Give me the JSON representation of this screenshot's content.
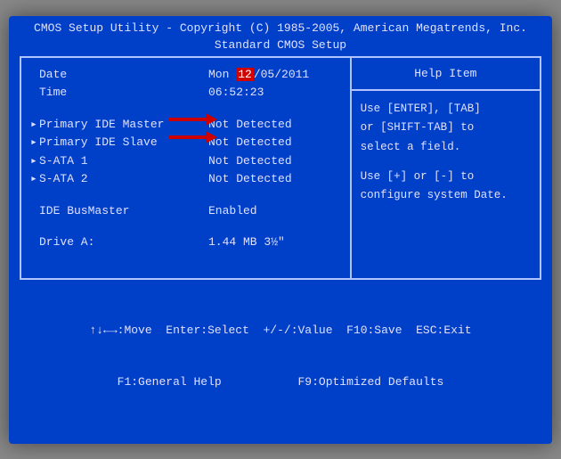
{
  "header": {
    "line1": "CMOS Setup Utility - Copyright (C) 1985-2005, American Megatrends, Inc.",
    "line2": "Standard CMOS Setup"
  },
  "fields": {
    "date_label": "Date",
    "date_value_prefix": "Mon ",
    "date_value_day": "12",
    "date_value_suffix": "/05/2011",
    "time_label": "Time",
    "time_value": "06:52:23",
    "pim_label": "Primary IDE Master",
    "pim_value": "Not Detected",
    "pis_label": "Primary IDE Slave",
    "pis_value": "Not Detected",
    "sata1_label": "S-ATA 1",
    "sata1_value": "Not Detected",
    "sata2_label": "S-ATA 2",
    "sata2_value": "Not Detected",
    "idebm_label": "IDE BusMaster",
    "idebm_value": "Enabled",
    "drivea_label": "Drive A:",
    "drivea_value": "1.44 MB 3½\""
  },
  "help": {
    "title": "Help Item",
    "body1": "Use [ENTER], [TAB]",
    "body2": "or [SHIFT-TAB] to",
    "body3": "select a field.",
    "body4": "Use [+] or [-] to",
    "body5": "configure system Date."
  },
  "footer": {
    "line1": "↑↓←→:Move  Enter:Select  +/-/:Value  F10:Save  ESC:Exit",
    "line2": "F1:General Help           F9:Optimized Defaults"
  }
}
